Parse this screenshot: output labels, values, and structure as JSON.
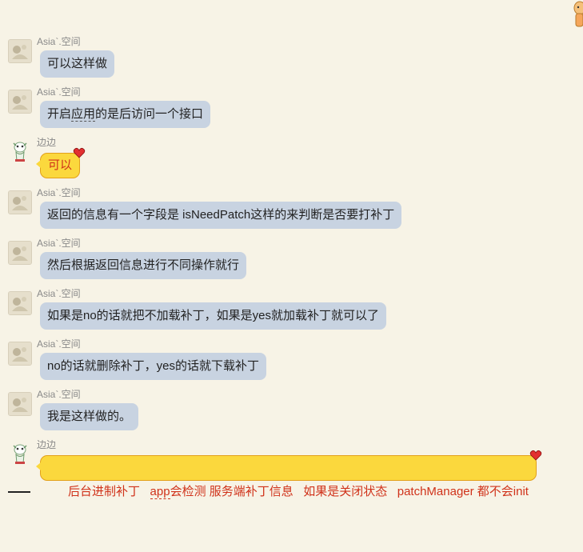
{
  "messages": [
    {
      "sender": "Asia`.空间",
      "text": "可以这样做",
      "who": "asia"
    },
    {
      "sender": "Asia`.空间",
      "text_parts": [
        "开启",
        "应用",
        "的是后访问一个接口"
      ],
      "who": "asia"
    },
    {
      "sender": "边边",
      "text": "可以",
      "who": "bian"
    },
    {
      "sender": "Asia`.空间",
      "text": "返回的信息有一个字段是 isNeedPatch这样的来判断是否要打补丁",
      "who": "asia"
    },
    {
      "sender": "Asia`.空间",
      "text": "然后根据返回信息进行不同操作就行",
      "who": "asia"
    },
    {
      "sender": "Asia`.空间",
      "text": "如果是no的话就把不加载补丁，如果是yes就加载补丁就可以了",
      "who": "asia"
    },
    {
      "sender": "Asia`.空间",
      "text": "no的话就删除补丁，yes的话就下载补丁",
      "who": "asia"
    },
    {
      "sender": "Asia`.空间",
      "text": "我是这样做的。",
      "who": "asia"
    },
    {
      "sender": "边边",
      "text_parts": [
        "后台进制补丁   ",
        "app",
        "会检测 服务端补丁信息   如果是关闭状态   patchManager 都不会init"
      ],
      "who": "bian"
    }
  ],
  "colors": {
    "background": "#f7f3e6",
    "asia_bubble": "#c8d3e1",
    "bian_bubble": "#fbd83d",
    "bian_text": "#d0321a"
  },
  "icons": {
    "asia_avatar": "avatar-asia-icon",
    "bian_avatar": "avatar-bian-icon",
    "heart": "heart-icon",
    "corner": "mascot-icon"
  }
}
